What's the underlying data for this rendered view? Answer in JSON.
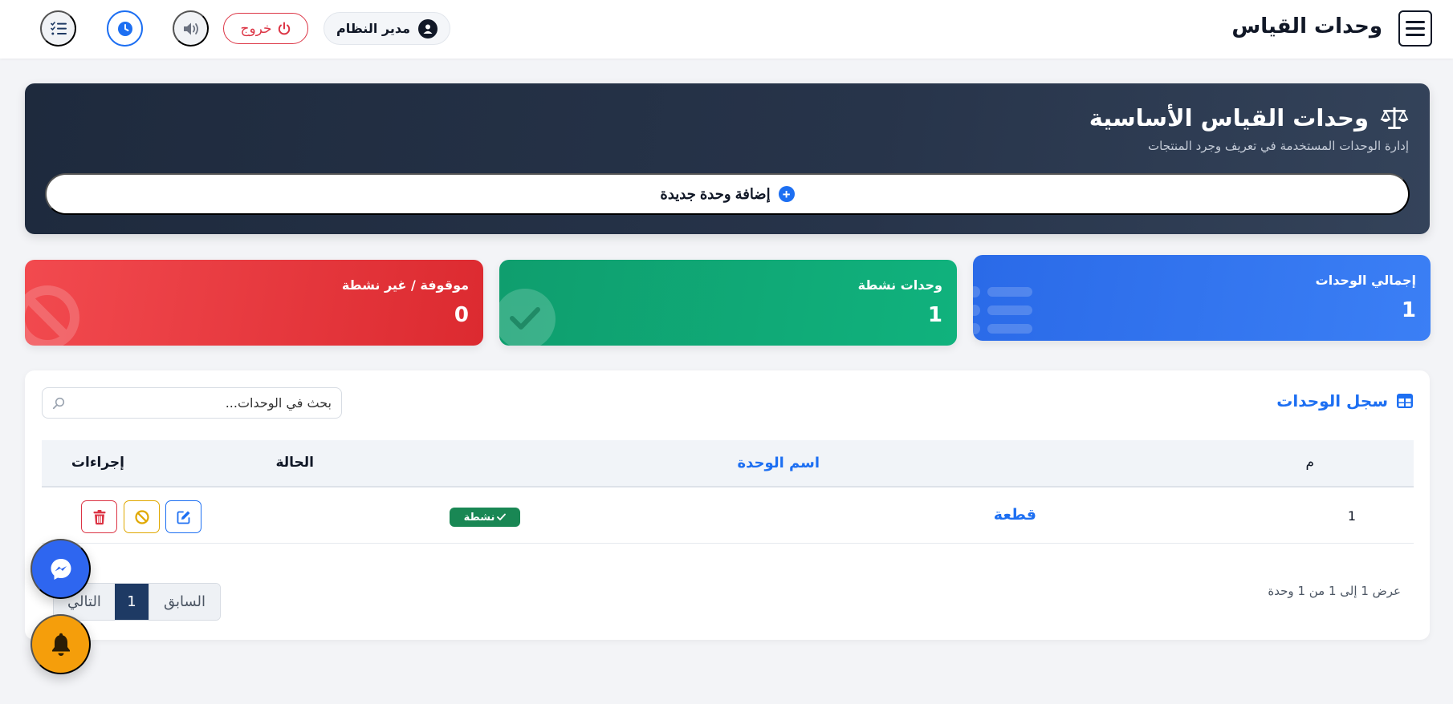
{
  "header": {
    "title": "وحدات القياس",
    "user_label": "مدير النظام",
    "logout_label": "خروج"
  },
  "hero": {
    "title": "وحدات القياس الأساسية",
    "subtitle": "إدارة الوحدات المستخدمة في تعريف وجرد المنتجات",
    "add_button_label": "إضافة وحدة جديدة"
  },
  "stats": {
    "total": {
      "label": "إجمالي الوحدات",
      "value": "1",
      "color": "#2a6ae8"
    },
    "active": {
      "label": "وحدات نشطة",
      "value": "1",
      "color": "#10b27d"
    },
    "stopped": {
      "label": "موقوفة / غير نشطة",
      "value": "0",
      "color": "#e53238"
    }
  },
  "units_table": {
    "title": "سجل الوحدات",
    "search_placeholder": "بحث في الوحدات...",
    "columns": {
      "num": "م",
      "name": "اسم الوحدة",
      "status": "الحالة",
      "actions": "إجراءات"
    },
    "rows": [
      {
        "num": "1",
        "name": "قطعة",
        "status": "نشطة"
      }
    ],
    "summary": "عرض 1 إلى 1 من 1 وحدة",
    "pagination": {
      "prev_label": "السابق",
      "current_page": "1",
      "next_label": "التالي"
    }
  },
  "icons": {
    "menu": "menu-icon",
    "user": "user-circle-icon",
    "logout": "power-icon",
    "sound": "speaker-icon",
    "clock": "clock-icon",
    "list": "list-check-icon",
    "scale": "balance-scale-icon",
    "add": "plus-circle-icon",
    "table": "table-icon",
    "search": "search-icon",
    "edit": "edit-icon",
    "block": "ban-icon",
    "delete": "trash-icon",
    "messenger": "messenger-icon",
    "bell": "bell-icon"
  },
  "colors": {
    "primary": "#1d6ff2",
    "dark_hero": "#1e2a3d",
    "success": "#198754",
    "danger": "#dc3545",
    "warning": "#e0a800",
    "page_bg": "#f3f4f7"
  }
}
